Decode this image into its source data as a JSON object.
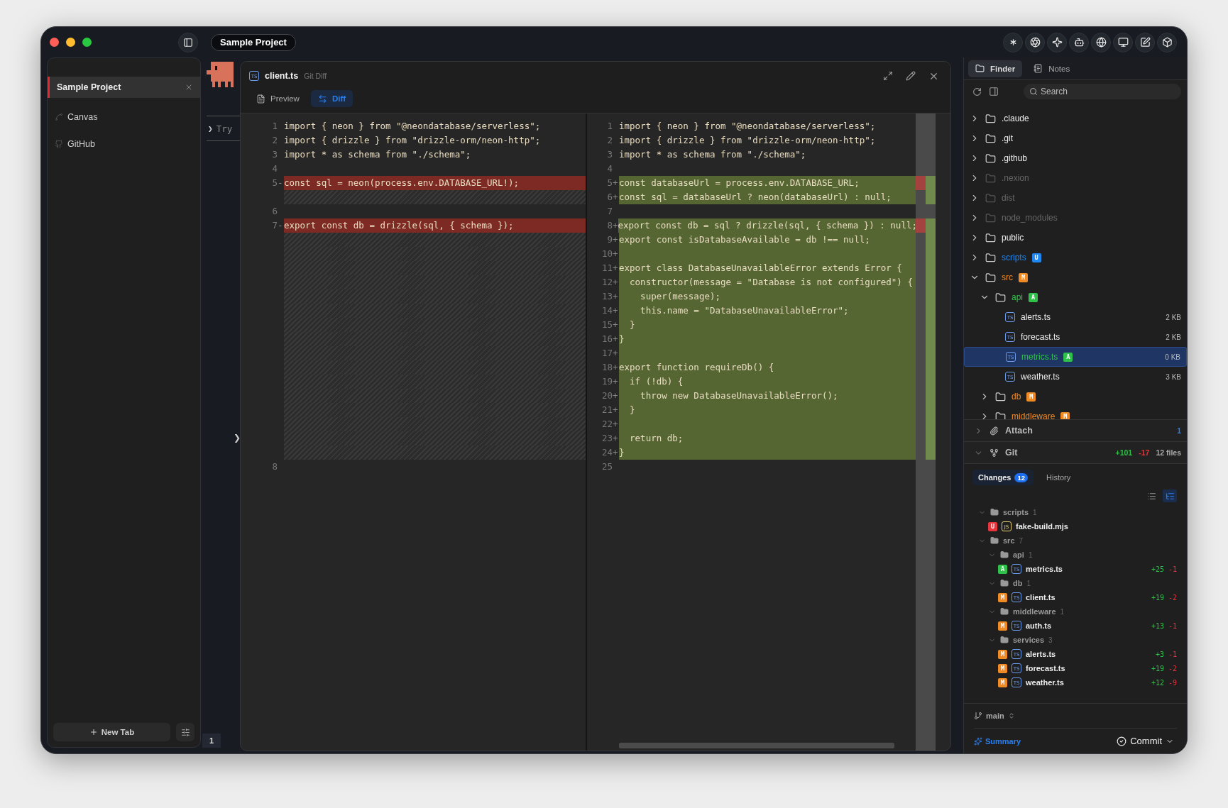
{
  "window": {
    "title": "Sample Project"
  },
  "sidebar": {
    "tabs": [
      {
        "label": "Sample Project",
        "selected": true
      }
    ],
    "items": [
      {
        "label": "Canvas",
        "kind": "canvas"
      },
      {
        "label": "GitHub",
        "kind": "github"
      }
    ],
    "new_tab": "New Tab"
  },
  "terminal": {
    "prompt": "❯",
    "text": "Try",
    "handle": "❯",
    "line_number": "1"
  },
  "editor": {
    "file": "client.ts",
    "file_type": "TS",
    "subtitle": "Git Diff",
    "tabs": [
      {
        "label": "Preview",
        "kind": "preview",
        "selected": false
      },
      {
        "label": "Diff",
        "kind": "diff",
        "selected": true
      }
    ],
    "rows": [
      {
        "left": {
          "kind": "context",
          "num": "1",
          "text": "import { neon } from \"@neondatabase/serverless\";"
        },
        "right": {
          "kind": "context",
          "num": "1",
          "text": "import { neon } from \"@neondatabase/serverless\";"
        }
      },
      {
        "left": {
          "kind": "context",
          "num": "2",
          "text": "import { drizzle } from \"drizzle-orm/neon-http\";"
        },
        "right": {
          "kind": "context",
          "num": "2",
          "text": "import { drizzle } from \"drizzle-orm/neon-http\";"
        }
      },
      {
        "left": {
          "kind": "context",
          "num": "3",
          "text": "import * as schema from \"./schema\";"
        },
        "right": {
          "kind": "context",
          "num": "3",
          "text": "import * as schema from \"./schema\";"
        }
      },
      {
        "left": {
          "kind": "context",
          "num": "4"
        },
        "right": {
          "kind": "context",
          "num": "4"
        }
      },
      {
        "left": {
          "kind": "removed",
          "num": "5",
          "sign": "-",
          "text": "const sql = neon(process.env.DATABASE_URL!);"
        },
        "right": {
          "kind": "added",
          "num": "5",
          "sign": "+",
          "text": "const databaseUrl = process.env.DATABASE_URL;"
        }
      },
      {
        "left": {
          "kind": "filler"
        },
        "right": {
          "kind": "added",
          "num": "6",
          "sign": "+",
          "text": "const sql = databaseUrl ? neon(databaseUrl) : null;"
        }
      },
      {
        "left": {
          "kind": "context",
          "num": "6"
        },
        "right": {
          "kind": "context",
          "num": "7"
        }
      },
      {
        "left": {
          "kind": "removed",
          "num": "7",
          "sign": "-",
          "text": "export const db = drizzle(sql, { schema });"
        },
        "right": {
          "kind": "added",
          "num": "8",
          "sign": "+",
          "text": "export const db = sql ? drizzle(sql, { schema }) : null;"
        }
      },
      {
        "left": {
          "kind": "filler"
        },
        "right": {
          "kind": "added",
          "num": "9",
          "sign": "+",
          "text": "export const isDatabaseAvailable = db !== null;"
        }
      },
      {
        "left": {
          "kind": "filler"
        },
        "right": {
          "kind": "added",
          "num": "10",
          "sign": "+"
        }
      },
      {
        "left": {
          "kind": "filler"
        },
        "right": {
          "kind": "added",
          "num": "11",
          "sign": "+",
          "text": "export class DatabaseUnavailableError extends Error {"
        }
      },
      {
        "left": {
          "kind": "filler"
        },
        "right": {
          "kind": "added",
          "num": "12",
          "sign": "+",
          "text": "  constructor(message = \"Database is not configured\") {"
        }
      },
      {
        "left": {
          "kind": "filler"
        },
        "right": {
          "kind": "added",
          "num": "13",
          "sign": "+",
          "text": "    super(message);"
        }
      },
      {
        "left": {
          "kind": "filler"
        },
        "right": {
          "kind": "added",
          "num": "14",
          "sign": "+",
          "text": "    this.name = \"DatabaseUnavailableError\";"
        }
      },
      {
        "left": {
          "kind": "filler"
        },
        "right": {
          "kind": "added",
          "num": "15",
          "sign": "+",
          "text": "  }"
        }
      },
      {
        "left": {
          "kind": "filler"
        },
        "right": {
          "kind": "added",
          "num": "16",
          "sign": "+",
          "text": "}"
        }
      },
      {
        "left": {
          "kind": "filler"
        },
        "right": {
          "kind": "added",
          "num": "17",
          "sign": "+"
        }
      },
      {
        "left": {
          "kind": "filler"
        },
        "right": {
          "kind": "added",
          "num": "18",
          "sign": "+",
          "text": "export function requireDb() {"
        }
      },
      {
        "left": {
          "kind": "filler"
        },
        "right": {
          "kind": "added",
          "num": "19",
          "sign": "+",
          "text": "  if (!db) {"
        }
      },
      {
        "left": {
          "kind": "filler"
        },
        "right": {
          "kind": "added",
          "num": "20",
          "sign": "+",
          "text": "    throw new DatabaseUnavailableError();"
        }
      },
      {
        "left": {
          "kind": "filler"
        },
        "right": {
          "kind": "added",
          "num": "21",
          "sign": "+",
          "text": "  }"
        }
      },
      {
        "left": {
          "kind": "filler"
        },
        "right": {
          "kind": "added",
          "num": "22",
          "sign": "+"
        }
      },
      {
        "left": {
          "kind": "filler"
        },
        "right": {
          "kind": "added",
          "num": "23",
          "sign": "+",
          "text": "  return db;"
        }
      },
      {
        "left": {
          "kind": "filler"
        },
        "right": {
          "kind": "added",
          "num": "24",
          "sign": "+",
          "text": "}"
        }
      },
      {
        "left": {
          "kind": "context",
          "num": "8"
        },
        "right": {
          "kind": "context",
          "num": "25"
        }
      }
    ]
  },
  "finder": {
    "tabs": [
      {
        "label": "Finder",
        "kind": "folder",
        "selected": true
      },
      {
        "label": "Notes",
        "kind": "notes",
        "selected": false
      }
    ],
    "search": {
      "placeholder": "Search"
    },
    "tree": [
      {
        "name": ".claude",
        "kind": "folder",
        "expanded": false,
        "ignored": false,
        "selected": false
      },
      {
        "name": ".git",
        "kind": "folder",
        "expanded": false,
        "ignored": false,
        "selected": false
      },
      {
        "name": ".github",
        "kind": "folder",
        "expanded": false,
        "ignored": false,
        "selected": false
      },
      {
        "name": ".nexion",
        "kind": "folder",
        "expanded": false,
        "ignored": true,
        "selected": false
      },
      {
        "name": "dist",
        "kind": "folder",
        "expanded": false,
        "ignored": true,
        "selected": false
      },
      {
        "name": "node_modules",
        "kind": "folder",
        "expanded": false,
        "ignored": true,
        "selected": false
      },
      {
        "name": "public",
        "kind": "folder",
        "expanded": false,
        "ignored": false,
        "selected": false
      },
      {
        "name": "scripts",
        "kind": "folder",
        "expanded": false,
        "ignored": false,
        "selected": false,
        "status": "U",
        "color": "#1e88f0"
      },
      {
        "name": "src",
        "kind": "folder",
        "expanded": true,
        "ignored": false,
        "selected": false,
        "status": "M",
        "color": "#f08a24",
        "children": [
          {
            "name": "api",
            "kind": "folder",
            "expanded": true,
            "ignored": false,
            "selected": false,
            "status": "A",
            "color": "#2ec24a",
            "children": [
              {
                "name": "alerts.ts",
                "kind": "file",
                "type": "TS",
                "size": "2 KB",
                "ignored": false,
                "selected": false
              },
              {
                "name": "forecast.ts",
                "kind": "file",
                "type": "TS",
                "size": "2 KB",
                "ignored": false,
                "selected": false
              },
              {
                "name": "metrics.ts",
                "kind": "file",
                "type": "TS",
                "size": "0 KB",
                "ignored": false,
                "selected": true,
                "status": "A",
                "color": "#2ec24a"
              },
              {
                "name": "weather.ts",
                "kind": "file",
                "type": "TS",
                "size": "3 KB",
                "ignored": false,
                "selected": false
              }
            ]
          },
          {
            "name": "db",
            "kind": "folder",
            "expanded": false,
            "ignored": false,
            "selected": false,
            "status": "M",
            "color": "#f08a24"
          },
          {
            "name": "middleware",
            "kind": "folder",
            "expanded": false,
            "ignored": false,
            "selected": false,
            "status": "M",
            "color": "#f08a24"
          }
        ]
      }
    ]
  },
  "attach": {
    "label": "Attach",
    "count": "1",
    "expanded": false
  },
  "git": {
    "label": "Git",
    "added": "+101",
    "removed": "-17",
    "files": "12 files",
    "expanded": true,
    "tabs": [
      {
        "label": "Changes",
        "count": "12",
        "selected": true
      },
      {
        "label": "History",
        "selected": false
      }
    ],
    "view_modes": [
      {
        "kind": "list",
        "selected": false
      },
      {
        "kind": "tree",
        "selected": true
      }
    ],
    "changes": [
      {
        "name": "scripts",
        "kind": "folder",
        "count": "1",
        "expanded": true,
        "children": [
          {
            "name": "fake-build.mjs",
            "kind": "file",
            "type": "JS",
            "status": "U",
            "color": "#e8343c"
          }
        ]
      },
      {
        "name": "src",
        "kind": "folder",
        "count": "7",
        "expanded": true,
        "children": [
          {
            "name": "api",
            "kind": "folder",
            "count": "1",
            "expanded": true,
            "children": [
              {
                "name": "metrics.ts",
                "kind": "file",
                "type": "TS",
                "status": "A",
                "color": "#2ec24a",
                "added": "+25",
                "removed": "-1"
              }
            ]
          },
          {
            "name": "db",
            "kind": "folder",
            "count": "1",
            "expanded": true,
            "children": [
              {
                "name": "client.ts",
                "kind": "file",
                "type": "TS",
                "status": "M",
                "color": "#f08a24",
                "added": "+19",
                "removed": "-2"
              }
            ]
          },
          {
            "name": "middleware",
            "kind": "folder",
            "count": "1",
            "expanded": true,
            "children": [
              {
                "name": "auth.ts",
                "kind": "file",
                "type": "TS",
                "status": "M",
                "color": "#f08a24",
                "added": "+13",
                "removed": "-1"
              }
            ]
          },
          {
            "name": "services",
            "kind": "folder",
            "count": "3",
            "expanded": true,
            "children": [
              {
                "name": "alerts.ts",
                "kind": "file",
                "type": "TS",
                "status": "M",
                "color": "#f08a24",
                "added": "+3",
                "removed": "-1"
              },
              {
                "name": "forecast.ts",
                "kind": "file",
                "type": "TS",
                "status": "M",
                "color": "#f08a24",
                "added": "+19",
                "removed": "-2"
              },
              {
                "name": "weather.ts",
                "kind": "file",
                "type": "TS",
                "status": "M",
                "color": "#f08a24",
                "added": "+12",
                "removed": "-9"
              }
            ]
          }
        ]
      }
    ],
    "branch": "main",
    "summary": "Summary",
    "commit": "Commit"
  }
}
